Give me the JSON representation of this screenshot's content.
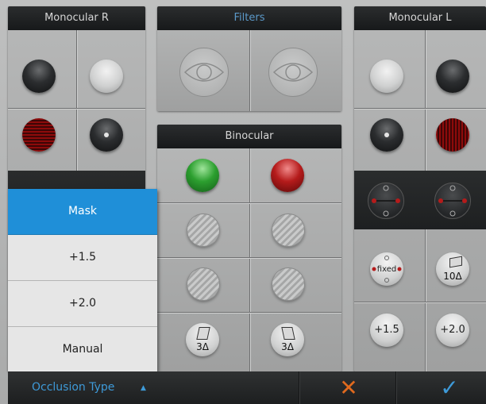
{
  "panels": {
    "monocular_r": {
      "title": "Monocular R"
    },
    "filters": {
      "title": "Filters"
    },
    "binocular": {
      "title": "Binocular"
    },
    "monocular_l": {
      "title": "Monocular L"
    }
  },
  "buttons": {
    "fixed_label": "fixed",
    "prism_10": "10Δ",
    "plus_15": "+1.5",
    "plus_20": "+2.0",
    "prism_3_left": "3Δ",
    "prism_3_right": "3Δ"
  },
  "occlusion_menu": {
    "items": [
      "Mask",
      "+1.5",
      "+2.0",
      "Manual"
    ],
    "selected": "Mask"
  },
  "bottom_bar": {
    "occlusion_label": "Occlusion Type",
    "caret": "▲",
    "cancel": "✕",
    "confirm": "✓"
  },
  "colors": {
    "accent_blue": "#1f8fd8",
    "cancel_orange": "#e06a1e",
    "header_dark": "#1d1f20"
  }
}
